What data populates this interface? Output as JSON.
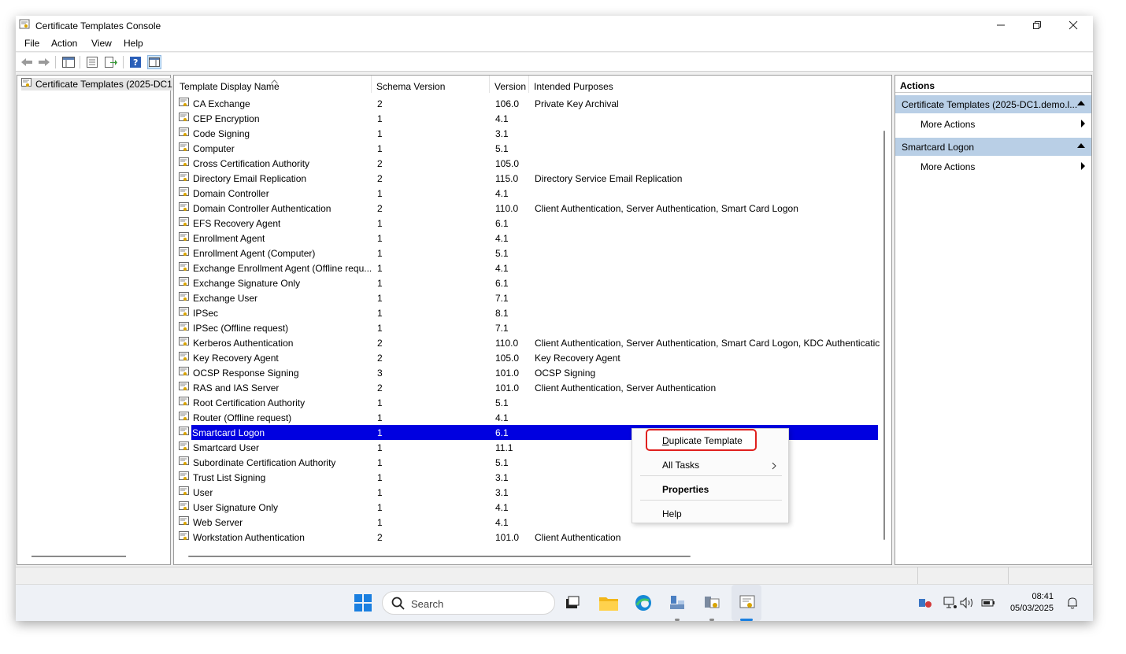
{
  "window": {
    "title": "Certificate Templates Console"
  },
  "menu": [
    "File",
    "Action",
    "View",
    "Help"
  ],
  "tree": {
    "root_label": "Certificate Templates (2025-DC1"
  },
  "columns": [
    "Template Display Name",
    "Schema Version",
    "Version",
    "Intended Purposes"
  ],
  "rows": [
    {
      "name": "CA Exchange",
      "schema": "2",
      "version": "106.0",
      "purposes": "Private Key Archival"
    },
    {
      "name": "CEP Encryption",
      "schema": "1",
      "version": "4.1",
      "purposes": ""
    },
    {
      "name": "Code Signing",
      "schema": "1",
      "version": "3.1",
      "purposes": ""
    },
    {
      "name": "Computer",
      "schema": "1",
      "version": "5.1",
      "purposes": ""
    },
    {
      "name": "Cross Certification Authority",
      "schema": "2",
      "version": "105.0",
      "purposes": ""
    },
    {
      "name": "Directory Email Replication",
      "schema": "2",
      "version": "115.0",
      "purposes": "Directory Service Email Replication"
    },
    {
      "name": "Domain Controller",
      "schema": "1",
      "version": "4.1",
      "purposes": ""
    },
    {
      "name": "Domain Controller Authentication",
      "schema": "2",
      "version": "110.0",
      "purposes": "Client Authentication, Server Authentication, Smart Card Logon"
    },
    {
      "name": "EFS Recovery Agent",
      "schema": "1",
      "version": "6.1",
      "purposes": ""
    },
    {
      "name": "Enrollment Agent",
      "schema": "1",
      "version": "4.1",
      "purposes": ""
    },
    {
      "name": "Enrollment Agent (Computer)",
      "schema": "1",
      "version": "5.1",
      "purposes": ""
    },
    {
      "name": "Exchange Enrollment Agent (Offline requ...",
      "schema": "1",
      "version": "4.1",
      "purposes": ""
    },
    {
      "name": "Exchange Signature Only",
      "schema": "1",
      "version": "6.1",
      "purposes": ""
    },
    {
      "name": "Exchange User",
      "schema": "1",
      "version": "7.1",
      "purposes": ""
    },
    {
      "name": "IPSec",
      "schema": "1",
      "version": "8.1",
      "purposes": ""
    },
    {
      "name": "IPSec (Offline request)",
      "schema": "1",
      "version": "7.1",
      "purposes": ""
    },
    {
      "name": "Kerberos Authentication",
      "schema": "2",
      "version": "110.0",
      "purposes": "Client Authentication, Server Authentication, Smart Card Logon, KDC Authenticatic"
    },
    {
      "name": "Key Recovery Agent",
      "schema": "2",
      "version": "105.0",
      "purposes": "Key Recovery Agent"
    },
    {
      "name": "OCSP Response Signing",
      "schema": "3",
      "version": "101.0",
      "purposes": "OCSP Signing"
    },
    {
      "name": "RAS and IAS Server",
      "schema": "2",
      "version": "101.0",
      "purposes": "Client Authentication, Server Authentication"
    },
    {
      "name": "Root Certification Authority",
      "schema": "1",
      "version": "5.1",
      "purposes": ""
    },
    {
      "name": "Router (Offline request)",
      "schema": "1",
      "version": "4.1",
      "purposes": ""
    },
    {
      "name": "Smartcard Logon",
      "schema": "1",
      "version": "6.1",
      "purposes": "",
      "selected": true
    },
    {
      "name": "Smartcard User",
      "schema": "1",
      "version": "11.1",
      "purposes": ""
    },
    {
      "name": "Subordinate Certification Authority",
      "schema": "1",
      "version": "5.1",
      "purposes": ""
    },
    {
      "name": "Trust List Signing",
      "schema": "1",
      "version": "3.1",
      "purposes": ""
    },
    {
      "name": "User",
      "schema": "1",
      "version": "3.1",
      "purposes": ""
    },
    {
      "name": "User Signature Only",
      "schema": "1",
      "version": "4.1",
      "purposes": ""
    },
    {
      "name": "Web Server",
      "schema": "1",
      "version": "4.1",
      "purposes": ""
    },
    {
      "name": "Workstation Authentication",
      "schema": "2",
      "version": "101.0",
      "purposes": "Client Authentication"
    }
  ],
  "actions": {
    "header": "Actions",
    "section1": "Certificate Templates (2025-DC1.demo.l...",
    "section1_more": "More Actions",
    "section2": "Smartcard Logon",
    "section2_more": "More Actions"
  },
  "context_menu": {
    "duplicate": "Duplicate Template",
    "all_tasks": "All Tasks",
    "properties": "Properties",
    "help": "Help"
  },
  "taskbar": {
    "search_label": "Search",
    "time": "08:41",
    "date": "05/03/2025"
  },
  "colors": {
    "selection": "#0000e0",
    "actions_section": "#b9cfe6",
    "highlight_border": "#e0201e"
  }
}
